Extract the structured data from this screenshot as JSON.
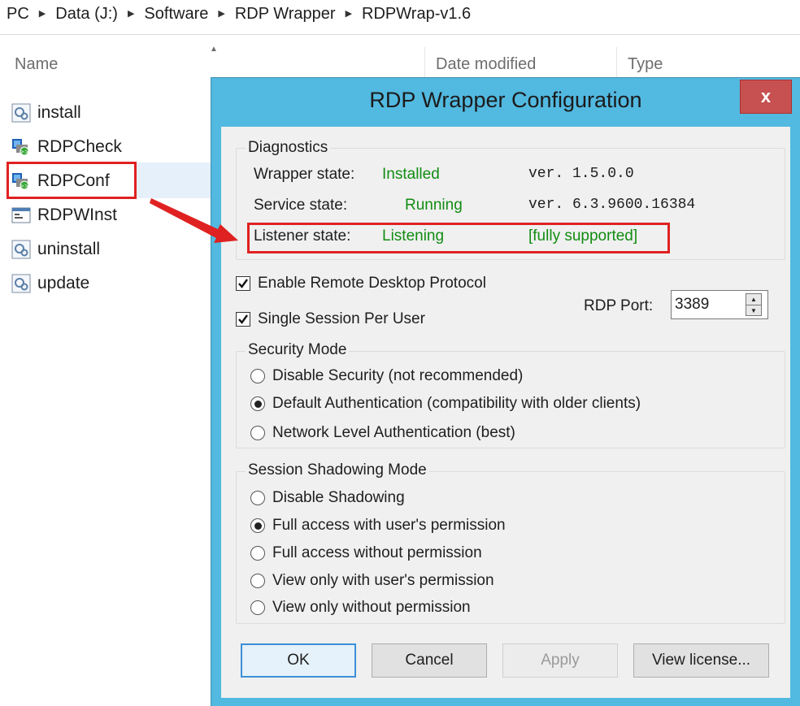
{
  "explorer": {
    "breadcrumb": [
      "PC",
      "Data (J:)",
      "Software",
      "RDP Wrapper",
      "RDPWrap-v1.6"
    ],
    "columns": {
      "name": "Name",
      "date_modified": "Date modified",
      "type": "Type"
    },
    "files": [
      {
        "name": "install",
        "icon": "batch-file-icon"
      },
      {
        "name": "RDPCheck",
        "icon": "remote-desktop-app-icon"
      },
      {
        "name": "RDPConf",
        "icon": "remote-desktop-app-icon"
      },
      {
        "name": "RDPWInst",
        "icon": "console-app-icon"
      },
      {
        "name": "uninstall",
        "icon": "batch-file-icon"
      },
      {
        "name": "update",
        "icon": "batch-file-icon"
      }
    ],
    "highlighted_file": "RDPConf"
  },
  "dialog": {
    "title": "RDP Wrapper Configuration",
    "close_label": "x",
    "diagnostics": {
      "label": "Diagnostics",
      "wrapper_label": "Wrapper state:",
      "wrapper_value": "Installed",
      "wrapper_version": "ver.  1.5.0.0",
      "service_label": "Service state:",
      "service_value": "Running",
      "service_version": "ver. 6.3.9600.16384",
      "listener_label": "Listener state:",
      "listener_value": "Listening",
      "listener_support": "[fully supported]"
    },
    "enable_rdp": {
      "label": "Enable Remote Desktop Protocol",
      "checked": true
    },
    "single_session": {
      "label": "Single Session Per User",
      "checked": true
    },
    "rdp_port": {
      "label": "RDP Port:",
      "value": "3389"
    },
    "security_mode": {
      "label": "Security Mode",
      "options": [
        "Disable Security (not recommended)",
        "Default Authentication (compatibility with older clients)",
        "Network Level Authentication (best)"
      ],
      "selected_index": 1
    },
    "shadowing_mode": {
      "label": "Session Shadowing Mode",
      "options": [
        "Disable Shadowing",
        "Full access with user's permission",
        "Full access without permission",
        "View only with user's permission",
        "View only without permission"
      ],
      "selected_index": 1
    },
    "buttons": {
      "ok": "OK",
      "cancel": "Cancel",
      "apply": "Apply",
      "view_license": "View license..."
    }
  },
  "colors": {
    "dialog_frame": "#52b9e0",
    "close_button": "#c75050",
    "status_green": "#128c12",
    "annotation_red": "#e02121"
  }
}
